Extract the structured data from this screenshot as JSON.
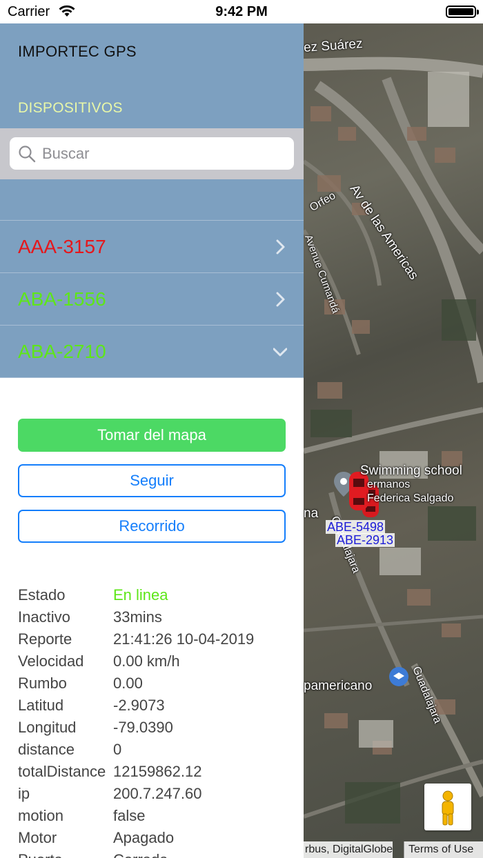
{
  "status_bar": {
    "carrier": "Carrier",
    "time": "9:42 PM"
  },
  "sidebar": {
    "app_title": "IMPORTEC GPS",
    "section_title": "DISPOSITIVOS",
    "search": {
      "placeholder": "Buscar",
      "value": ""
    },
    "devices": [
      {
        "plate": "AAA-3157",
        "color": "#e5171c",
        "expanded": false
      },
      {
        "plate": "ABA-1556",
        "color": "#5ee619",
        "expanded": false
      },
      {
        "plate": "ABA-2710",
        "color": "#5ee619",
        "expanded": true
      }
    ],
    "buttons": {
      "take_from_map": "Tomar del mapa",
      "follow": "Seguir",
      "route": "Recorrido"
    },
    "details": [
      {
        "key": "Estado",
        "value": "En linea",
        "color": "#5ee619"
      },
      {
        "key": "Inactivo",
        "value": "33mins"
      },
      {
        "key": "Reporte",
        "value": "21:41:26 10-04-2019"
      },
      {
        "key": "Velocidad",
        "value": "0.00 km/h"
      },
      {
        "key": "Rumbo",
        "value": "0.00"
      },
      {
        "key": "Latitud",
        "value": "-2.9073"
      },
      {
        "key": "Longitud",
        "value": "-79.0390"
      },
      {
        "key": "distance",
        "value": "0"
      },
      {
        "key": "totalDistance",
        "value": "12159862.12"
      },
      {
        "key": "ip",
        "value": "200.7.247.60"
      },
      {
        "key": "motion",
        "value": "false"
      },
      {
        "key": "Motor",
        "value": "Apagado"
      },
      {
        "key": "Puerta",
        "value": "Cerrada"
      }
    ]
  },
  "map": {
    "street_labels": [
      "ez Suárez",
      "Av de las Americas",
      "Orfeo",
      "Avenue Cumandá",
      "Guadalajara",
      "Guadalajara",
      "na",
      "pamericano"
    ],
    "poi_labels": [
      "Swimming school",
      "ermanos",
      "Federica Salgado"
    ],
    "vehicles": [
      "ABE-5498",
      "ABE-2913"
    ],
    "attribution": "rbus, DigitalGlobe",
    "terms": "Terms of Use",
    "colors": {
      "vehicle_label": "#1c1cd8",
      "vehicle": "#d8191f"
    }
  }
}
